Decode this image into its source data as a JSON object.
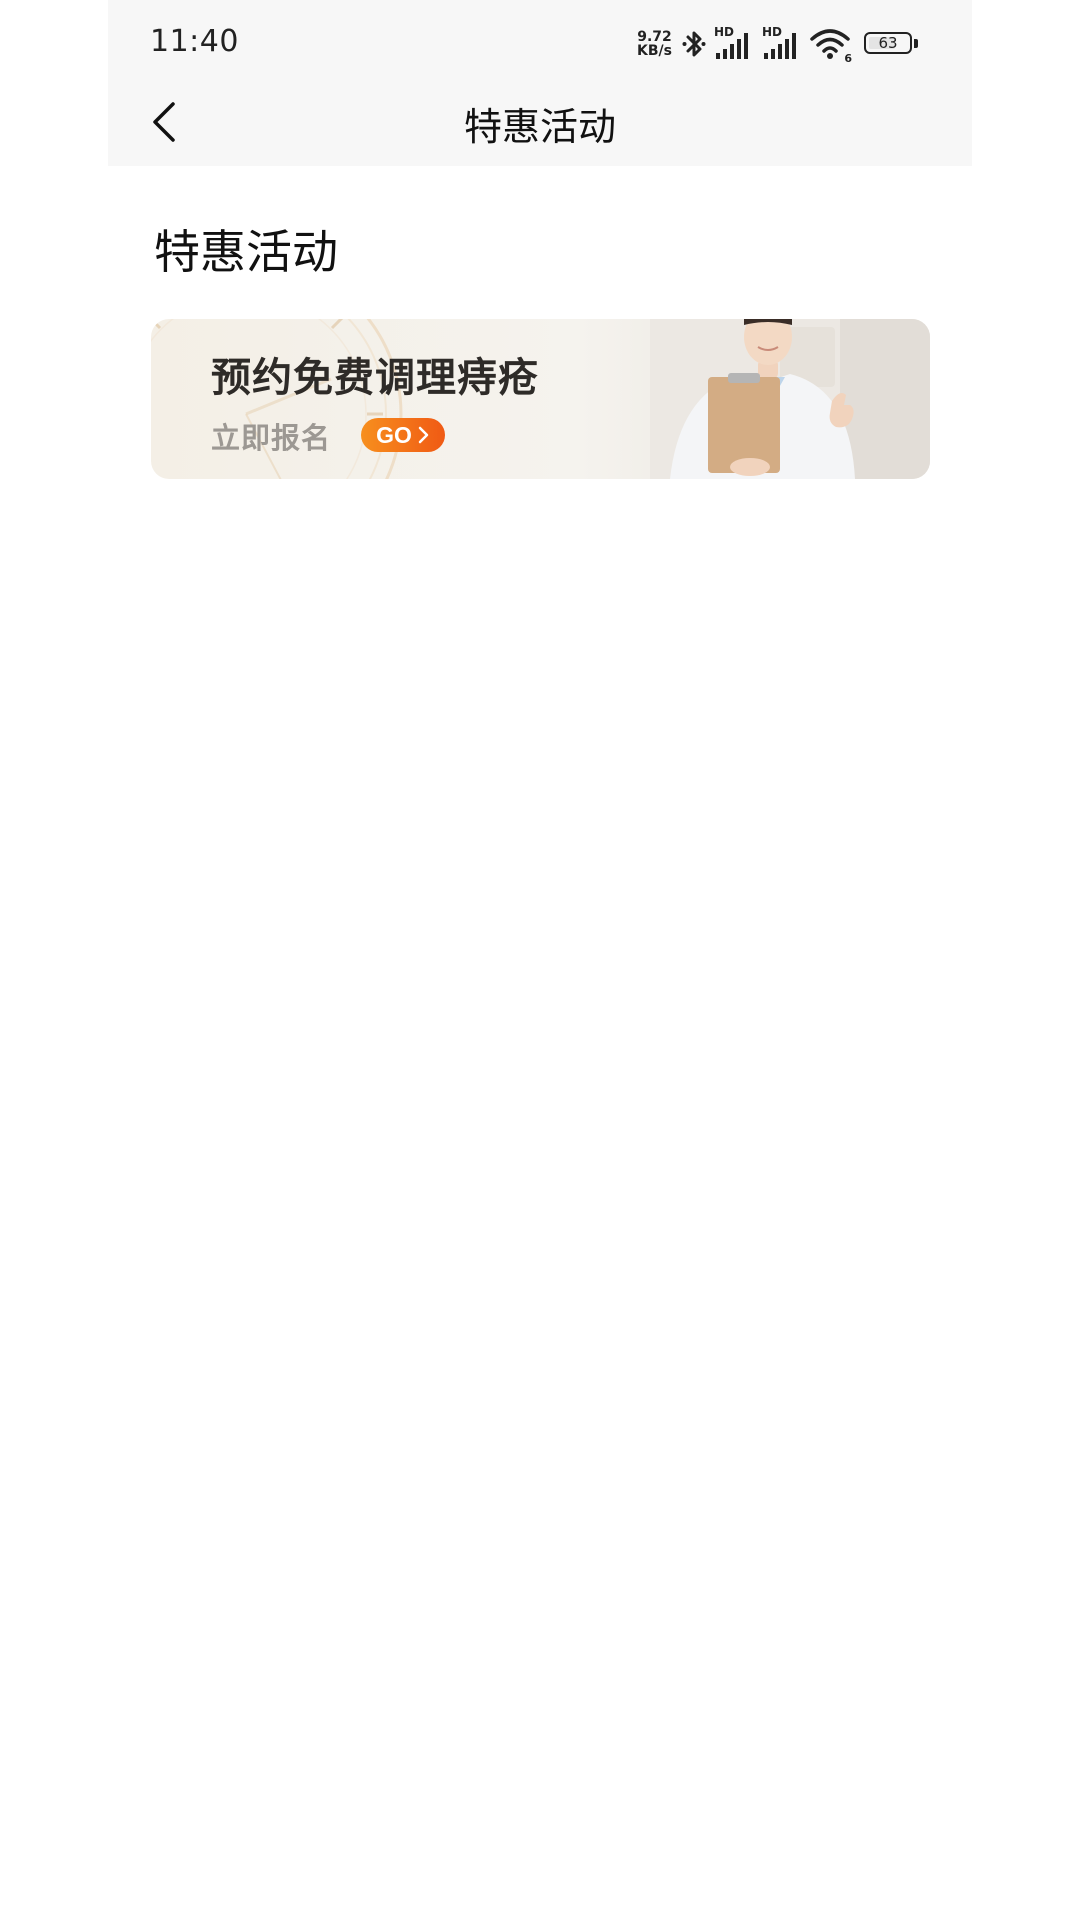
{
  "status_bar": {
    "time": "11:40",
    "net_speed_value": "9.72",
    "net_speed_unit": "KB/s",
    "signal1_label": "HD",
    "signal2_label": "HD",
    "wifi_badge": "6",
    "battery_level": "63",
    "icons": [
      "bluetooth-icon",
      "signal-icon",
      "signal-icon",
      "wifi-icon",
      "battery-icon"
    ]
  },
  "header": {
    "title": "特惠活动",
    "back_icon": "chevron-left-icon"
  },
  "section": {
    "title": "特惠活动"
  },
  "banner": {
    "headline": "预约免费调理痔疮",
    "subtext": "立即报名",
    "go_label": "GO",
    "go_icon": "chevron-right-icon",
    "accent_color": "#f36a16"
  }
}
